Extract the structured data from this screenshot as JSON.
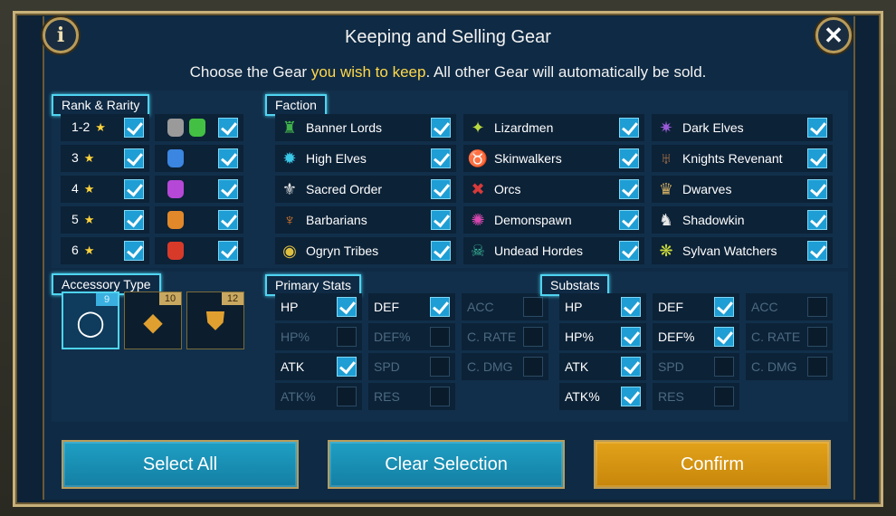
{
  "title": "Keeping and Selling Gear",
  "subtitle": {
    "prefix": "Choose the Gear ",
    "highlight": "you wish to keep",
    "suffix": ". All other Gear will automatically be sold."
  },
  "info_glyph": "i",
  "close_glyph": "✕",
  "rank": {
    "tag": "Rank & Rarity",
    "rows": [
      {
        "label": "1-2",
        "checked": true,
        "colors": [
          "#9a9a9a",
          "#43c043"
        ],
        "rarity_checked": true
      },
      {
        "label": "3",
        "checked": true,
        "colors": [
          "#3b86e0"
        ],
        "rarity_checked": true
      },
      {
        "label": "4",
        "checked": true,
        "colors": [
          "#b548d6"
        ],
        "rarity_checked": true
      },
      {
        "label": "5",
        "checked": true,
        "colors": [
          "#e0882a"
        ],
        "rarity_checked": true
      },
      {
        "label": "6",
        "checked": true,
        "colors": [
          "#d83a2a"
        ],
        "rarity_checked": true
      }
    ],
    "star": "★"
  },
  "faction": {
    "tag": "Faction",
    "columns": [
      [
        {
          "name": "Banner Lords",
          "icon": "banner-lords-icon",
          "glyph": "♜",
          "color": "#3fb04a",
          "checked": true
        },
        {
          "name": "High Elves",
          "icon": "high-elves-icon",
          "glyph": "✹",
          "color": "#3ac8e8",
          "checked": true
        },
        {
          "name": "Sacred Order",
          "icon": "sacred-order-icon",
          "glyph": "⚜",
          "color": "#e8e8e8",
          "checked": true
        },
        {
          "name": "Barbarians",
          "icon": "barbarians-icon",
          "glyph": "♆",
          "color": "#e07a2a",
          "checked": true
        },
        {
          "name": "Ogryn Tribes",
          "icon": "ogryn-tribes-icon",
          "glyph": "◉",
          "color": "#e0c040",
          "checked": true
        }
      ],
      [
        {
          "name": "Lizardmen",
          "icon": "lizardmen-icon",
          "glyph": "✦",
          "color": "#b8d840",
          "checked": true
        },
        {
          "name": "Skinwalkers",
          "icon": "skinwalkers-icon",
          "glyph": "♉",
          "color": "#c8a878",
          "checked": true
        },
        {
          "name": "Orcs",
          "icon": "orcs-icon",
          "glyph": "✖",
          "color": "#d83a3a",
          "checked": true
        },
        {
          "name": "Demonspawn",
          "icon": "demonspawn-icon",
          "glyph": "✺",
          "color": "#d848b0",
          "checked": true
        },
        {
          "name": "Undead Hordes",
          "icon": "undead-hordes-icon",
          "glyph": "☠",
          "color": "#3ab89a",
          "checked": true
        }
      ],
      [
        {
          "name": "Dark Elves",
          "icon": "dark-elves-icon",
          "glyph": "✷",
          "color": "#9a5ad8",
          "checked": true
        },
        {
          "name": "Knights Revenant",
          "icon": "knights-revenant-icon",
          "glyph": "♅",
          "color": "#b87a48",
          "checked": true
        },
        {
          "name": "Dwarves",
          "icon": "dwarves-icon",
          "glyph": "♛",
          "color": "#c8a860",
          "checked": true
        },
        {
          "name": "Shadowkin",
          "icon": "shadowkin-icon",
          "glyph": "♞",
          "color": "#e8e8e8",
          "checked": true
        },
        {
          "name": "Sylvan Watchers",
          "icon": "sylvan-watchers-icon",
          "glyph": "❋",
          "color": "#c8d838",
          "checked": true
        }
      ]
    ]
  },
  "accessory": {
    "tag": "Accessory Type",
    "items": [
      {
        "name": "ring",
        "icon": "ring-icon",
        "glyph": "◯",
        "badge": "9",
        "selected": true
      },
      {
        "name": "amulet",
        "icon": "amulet-icon",
        "glyph": "◆",
        "badge": "10",
        "selected": false
      },
      {
        "name": "banner",
        "icon": "banner-icon",
        "glyph": "⛊",
        "badge": "12",
        "selected": false
      }
    ]
  },
  "primary": {
    "tag": "Primary Stats",
    "columns": [
      [
        {
          "label": "HP",
          "checked": true,
          "enabled": true
        },
        {
          "label": "HP%",
          "checked": false,
          "enabled": false
        },
        {
          "label": "ATK",
          "checked": true,
          "enabled": true
        },
        {
          "label": "ATK%",
          "checked": false,
          "enabled": false
        }
      ],
      [
        {
          "label": "DEF",
          "checked": true,
          "enabled": true
        },
        {
          "label": "DEF%",
          "checked": false,
          "enabled": false
        },
        {
          "label": "SPD",
          "checked": false,
          "enabled": false
        },
        {
          "label": "RES",
          "checked": false,
          "enabled": false
        }
      ],
      [
        {
          "label": "ACC",
          "checked": false,
          "enabled": false
        },
        {
          "label": "C. RATE",
          "checked": false,
          "enabled": false
        },
        {
          "label": "C. DMG",
          "checked": false,
          "enabled": false
        }
      ]
    ]
  },
  "substats": {
    "tag": "Substats",
    "columns": [
      [
        {
          "label": "HP",
          "checked": true,
          "enabled": true
        },
        {
          "label": "HP%",
          "checked": true,
          "enabled": true
        },
        {
          "label": "ATK",
          "checked": true,
          "enabled": true
        },
        {
          "label": "ATK%",
          "checked": true,
          "enabled": true
        }
      ],
      [
        {
          "label": "DEF",
          "checked": true,
          "enabled": true
        },
        {
          "label": "DEF%",
          "checked": true,
          "enabled": true
        },
        {
          "label": "SPD",
          "checked": false,
          "enabled": false
        },
        {
          "label": "RES",
          "checked": false,
          "enabled": false
        }
      ],
      [
        {
          "label": "ACC",
          "checked": false,
          "enabled": false
        },
        {
          "label": "C. RATE",
          "checked": false,
          "enabled": false
        },
        {
          "label": "C. DMG",
          "checked": false,
          "enabled": false
        }
      ]
    ]
  },
  "buttons": {
    "select_all": "Select All",
    "clear": "Clear Selection",
    "confirm": "Confirm"
  }
}
